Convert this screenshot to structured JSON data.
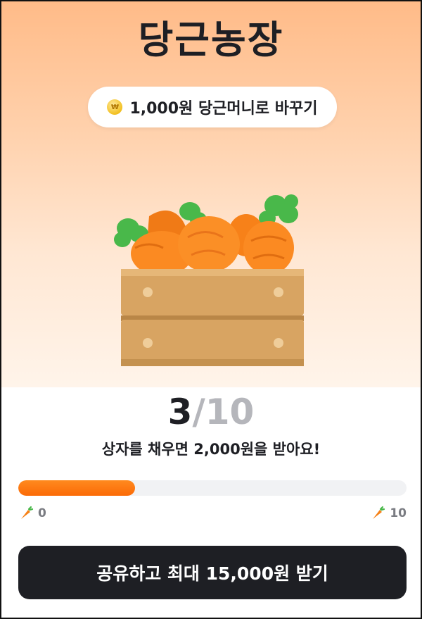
{
  "header": {
    "title": "당근농장"
  },
  "exchange": {
    "coin_symbol": "₩",
    "label": "1,000원 당근머니로 바꾸기"
  },
  "progress": {
    "current": "3",
    "separator": "/",
    "total": "10",
    "fraction": 0.3,
    "reward_text": "상자를 채우면 2,000원을 받아요!",
    "scale_min": "0",
    "scale_max": "10",
    "fill_color": "#fb6a06"
  },
  "cta": {
    "label": "공유하고 최대 15,000원 받기"
  },
  "icons": {
    "crate": "carrot-crate-illustration",
    "scale": "carrot-icon",
    "coin": "coin-icon"
  }
}
